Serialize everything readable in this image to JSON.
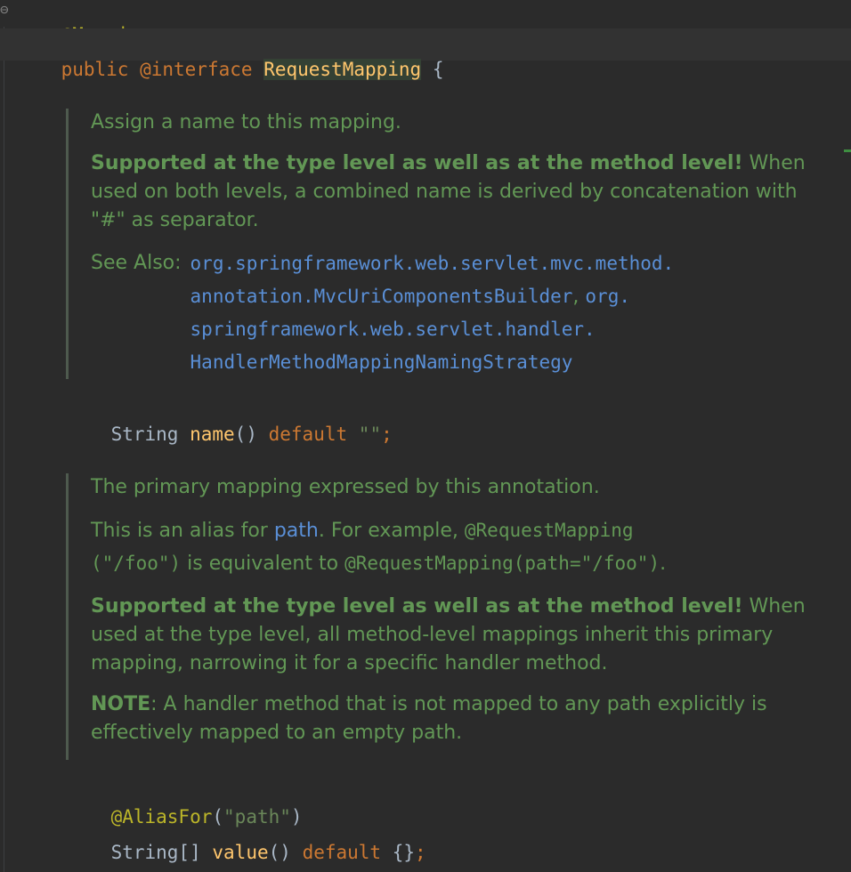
{
  "editor": {
    "line_top_annotation": "@Mapping",
    "decl": {
      "kw_public": "public",
      "kw_interface": "@interface",
      "type_name": "RequestMapping",
      "open_brace": "{"
    },
    "doc1": {
      "summary": "Assign a name to this mapping.",
      "bold": "Supported at the type level as well as at the method level!",
      "rest": "When used on both levels, a combined name is derived by concatenation with \"#\" as separator.",
      "see_also_label": "See Also:",
      "link1_a": "org.springframework.web.servlet.mvc.method.",
      "link1_b": "annotation.MvcUriComponentsBuilder",
      "sep": ",",
      "link2_a": "org.",
      "link2_b": "springframework.web.servlet.handler.",
      "link2_c": "HandlerMethodMappingNamingStrategy"
    },
    "line_name": {
      "type": "String",
      "method": "name",
      "parens": "()",
      "kw_default": "default",
      "value": "\"\"",
      "semi": ";"
    },
    "doc2": {
      "summary": "The primary mapping expressed by this annotation.",
      "alias_pre": "This is an alias for",
      "alias_link": "path",
      "alias_mid": ". For example,",
      "code1": "@RequestMapping",
      "code2": "(\"/foo\")",
      "alias_mid2": "is equivalent to",
      "code3": "@RequestMapping(path=\"/foo\")",
      "alias_end": ".",
      "bold": "Supported at the type level as well as at the method level!",
      "rest": "When used at the type level, all method-level mappings inherit this primary mapping, narrowing it for a specific handler method.",
      "note_label": "NOTE",
      "note_text": ": A handler method that is not mapped to any path explicitly is effectively mapped to an empty path."
    },
    "line_alias": {
      "annotation": "@AliasFor",
      "open": "(",
      "value": "\"path\"",
      "close": ")"
    },
    "line_value": {
      "type": "String[]",
      "method": "value",
      "parens": "()",
      "kw_default": "default",
      "braces": "{}",
      "semi": ";"
    }
  }
}
